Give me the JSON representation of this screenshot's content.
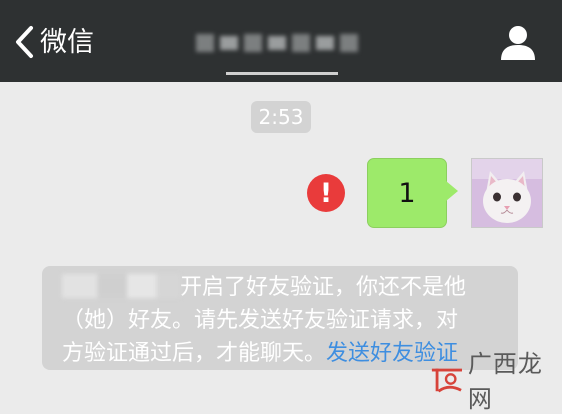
{
  "nav": {
    "back_label": "微信",
    "title": "",
    "icons": {
      "back": "chevron-left-icon",
      "profile": "person-icon"
    }
  },
  "chat": {
    "timestamp": "2:53",
    "message": {
      "text": "1",
      "status_icon": "error-icon"
    },
    "notice": {
      "text_line1": "开启了好友验证，你还不是他",
      "text_line2": "（她）好友。请先发送好友验证请求，对",
      "text_line3": "方验证通过后，才能聊天。",
      "link": "发送好友验证"
    }
  },
  "colors": {
    "nav_bg": "#2e3132",
    "chat_bg": "#ebebeb",
    "bubble": "#9dea6a",
    "error": "#e93b3b",
    "link": "#3e8ee0",
    "pill": "#d3d3d3"
  },
  "watermark": {
    "text": "广西龙网"
  }
}
